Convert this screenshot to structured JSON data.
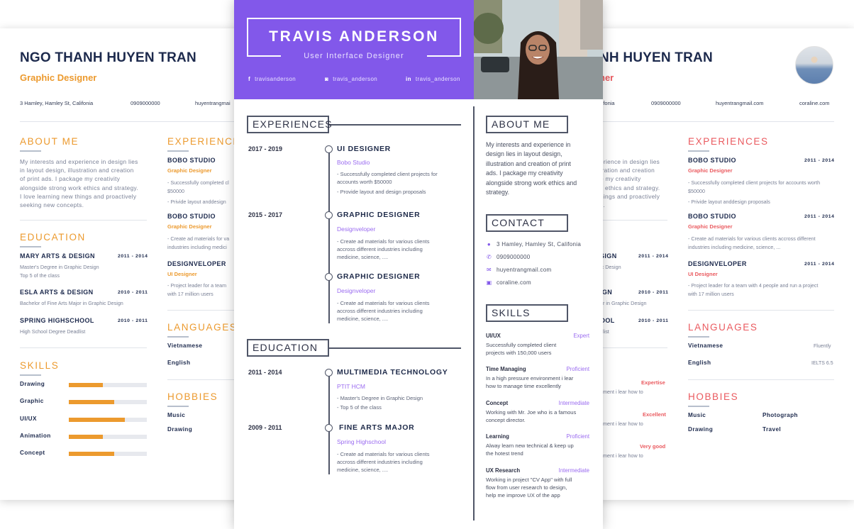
{
  "left_cv": {
    "name": "NGO THANH HUYEN TRAN",
    "role": "Graphic Designer",
    "accent": "#ec9a2e",
    "contact": {
      "address": "3 Hamley, Hamley St, Califonia",
      "phone": "0909000000",
      "email": "huyentrangmai"
    },
    "about": {
      "title": "ABOUT ME",
      "lines": [
        "My interests and experience in design lies",
        "in layout design, illustration and creation",
        "of print ads. I package my creativity",
        "alongside strong work ethics and strategy.",
        "I love learning new things and proactively",
        "seeking new concepts."
      ]
    },
    "education": {
      "title": "EDUCATION",
      "items": [
        {
          "school": "MARY ARTS & DESIGN",
          "years": "2011 - 2014",
          "lines": [
            "Master's Degree in Graphic Design",
            "Top 5 of the class"
          ]
        },
        {
          "school": "ESLA ARTS & DESIGN",
          "years": "2010 - 2011",
          "lines": [
            "Bachelor of Fine Arts Major in Graphic Design"
          ]
        },
        {
          "school": "SPRING HIGHSCHOOL",
          "years": "2010 - 2011",
          "lines": [
            "High School Degree Deadlist"
          ]
        }
      ]
    },
    "skills": {
      "title": "SKILLS",
      "items": [
        {
          "name": "Drawing",
          "level": 0.44
        },
        {
          "name": "Graphic",
          "level": 0.58
        },
        {
          "name": "UI/UX",
          "level": 0.72
        },
        {
          "name": "Animation",
          "level": 0.44
        },
        {
          "name": "Concept",
          "level": 0.58
        }
      ]
    },
    "experiences": {
      "title": "EXPERIENCES",
      "items": [
        {
          "company": "BOBO STUDIO",
          "role": "Graphic Designer",
          "lines": [
            "- Successfully completed cl",
            "$50000",
            "- Privide layout anddesign"
          ]
        },
        {
          "company": "BOBO STUDIO",
          "role": "Graphic Designer",
          "lines": [
            "- Create ad materials for va",
            "industries including medici"
          ]
        },
        {
          "company": "DESIGNVELOPER",
          "role": "UI Designer",
          "lines": [
            "- Project leader for a team",
            "with 17 million users"
          ]
        }
      ]
    },
    "languages": {
      "title": "LANGUAGES",
      "items": [
        "Vietnamese",
        "English"
      ]
    },
    "hobbies": {
      "title": "HOBBIES",
      "items": [
        "Music",
        "Drawing"
      ]
    }
  },
  "center_cv": {
    "name": "TRAVIS ANDERSON",
    "role": "User Interface Designer",
    "accent": "#8258ea",
    "social": [
      {
        "icon": "facebook-icon",
        "glyph": "f",
        "handle": "travisanderson"
      },
      {
        "icon": "instagram-icon",
        "glyph": "◙",
        "handle": "travis_anderson"
      },
      {
        "icon": "linkedin-icon",
        "glyph": "in",
        "handle": "travis_anderson"
      }
    ],
    "experiences": {
      "title": "EXPERIENCES",
      "items": [
        {
          "years": "2017 - 2019",
          "title": "UI DESIGNER",
          "company": "Bobo Studio",
          "lines": [
            "- Successfully completed client projects for",
            "accounts worth $50000",
            "- Provide layout and design proposals"
          ]
        },
        {
          "years": "2015 - 2017",
          "title": "GRAPHIC DESIGNER",
          "company": "Designveloper",
          "lines": [
            "- Create ad materials for various clients",
            "accross different industries including",
            "medicine, science, ...."
          ]
        },
        {
          "years": "",
          "title": "GRAPHIC DESIGNER",
          "company": "Designveloper",
          "lines": [
            "- Create ad materials for various clients",
            "accross different industries including",
            "medicine, science, ...."
          ]
        }
      ]
    },
    "education": {
      "title": "EDUCATION",
      "items": [
        {
          "years": "2011 - 2014",
          "title": "MULTIMEDIA TECHNOLOGY",
          "school": "PTIT HCM",
          "lines": [
            "- Master's Degree in Graphic Design",
            "- Top 5 of the class"
          ]
        },
        {
          "years": "2009 - 2011",
          "title": "FINE ARTS MAJOR",
          "school": "Spring Highschool",
          "lines": [
            "- Create ad materials for various clients",
            "accross different industries including",
            "medicine, science, ...."
          ]
        }
      ]
    },
    "about": {
      "title": "ABOUT ME",
      "lines": [
        "My interests and experience in",
        "design lies in layout design,",
        "illustration and creation of print",
        "ads. I package my creativity",
        "alongside strong work ethics and",
        "strategy."
      ]
    },
    "contact": {
      "title": "CONTACT",
      "items": [
        {
          "icon": "location-pin-icon",
          "glyph": "●",
          "text": "3 Hamley, Hamley St, Califonia"
        },
        {
          "icon": "phone-icon",
          "glyph": "✆",
          "text": "0909000000"
        },
        {
          "icon": "mail-icon",
          "glyph": "✉",
          "text": "huyentrangmail.com"
        },
        {
          "icon": "website-icon",
          "glyph": "▣",
          "text": "coraline.com"
        }
      ]
    },
    "skills": {
      "title": "SKILLS",
      "items": [
        {
          "name": "UI/UX",
          "level": "Expert",
          "lines": [
            "Successfully completed client",
            "projects with 150,000 users"
          ]
        },
        {
          "name": "Time Managing",
          "level": "Proficient",
          "lines": [
            "In a high pressure environment i lear",
            "how to manage time excellently"
          ]
        },
        {
          "name": "Concept",
          "level": "Intermediate",
          "lines": [
            "Working with Mr. Joe who is a famous",
            "concept director."
          ]
        },
        {
          "name": "Learning",
          "level": "Proficient",
          "lines": [
            "Alway learn new technical & keep up",
            "the hotest trend"
          ]
        },
        {
          "name": "UX Research",
          "level": "Intermediate",
          "lines": [
            "Working in project \"CV App\" with full",
            "flow from user research to design,",
            "help me improve UX of the app"
          ]
        }
      ]
    }
  },
  "right_cv": {
    "name_visible": "NH HUYEN TRAN",
    "role_visible": "ner",
    "accent": "#ea5a5f",
    "contact": {
      "address_visible": "lifonia",
      "phone": "0909000000",
      "email": "huyentrangmail.com",
      "website": "coraline.com"
    },
    "about_visible": [
      "erience in design lies",
      "tration and creation",
      "e my creativity",
      "k ethics and strategy.",
      "hings and proactively",
      "s."
    ],
    "education_visible": [
      {
        "school": "SIGN",
        "years": "2011 - 2014",
        "line": "ic Design"
      },
      {
        "school": "IGN",
        "years": "2010 - 2011",
        "line": "or in Graphic Design"
      },
      {
        "school": "OOL",
        "years": "2010 - 2011",
        "line": "dlist"
      }
    ],
    "skills_visible": [
      {
        "level": "Expertise",
        "line": "nment i lear how to"
      },
      {
        "level": "Excellent",
        "line": "nment i lear how to"
      },
      {
        "level": "Very good",
        "line": "nment i lear how to"
      }
    ],
    "experiences": {
      "title": "EXPERIENCES",
      "items": [
        {
          "company": "BOBO STUDIO",
          "years": "2011 - 2014",
          "role": "Graphic Designer",
          "lines": [
            "- Successfully completed client projects for accounts worth",
            "$50000",
            "- Privide layout anddesign proposals"
          ]
        },
        {
          "company": "BOBO STUDIO",
          "years": "2011 - 2014",
          "role": "Graphic Designer",
          "lines": [
            "- Create ad materials for various clients accross different",
            "industries including medicine, science, ..."
          ]
        },
        {
          "company": "DESIGNVELOPER",
          "years": "2011 - 2014",
          "role": "UI Designer",
          "lines": [
            "- Project leader for a team with 4 people and run a project",
            "with 17 million users"
          ]
        }
      ]
    },
    "languages": {
      "title": "LANGUAGES",
      "items": [
        {
          "name": "Vietnamese",
          "level": "Fluently"
        },
        {
          "name": "English",
          "level": "IELTS 6.5"
        }
      ]
    },
    "hobbies": {
      "title": "HOBBIES",
      "items": [
        "Music",
        "Photograph",
        "Drawing",
        "Travel"
      ]
    }
  }
}
